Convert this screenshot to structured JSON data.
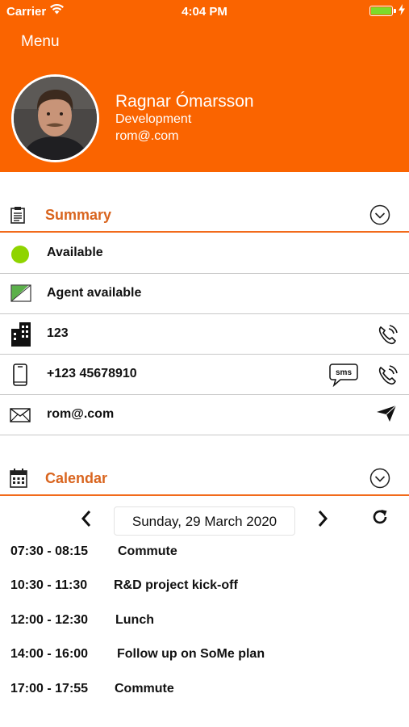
{
  "status_bar": {
    "carrier": "Carrier",
    "time": "4:04 PM",
    "battery_color": "#7ddb2a"
  },
  "header": {
    "menu_label": "Menu",
    "background_color": "#fa6400",
    "profile": {
      "name": "Ragnar Ómarsson",
      "department": "Development",
      "email": "rom@.com"
    }
  },
  "summary": {
    "title": "Summary",
    "icon": "clipboard-icon",
    "rows": [
      {
        "icon": "green-dot-icon",
        "text": "Available"
      },
      {
        "icon": "agent-status-icon",
        "text": "Agent available"
      },
      {
        "icon": "building-icon",
        "text": "123",
        "actions": [
          "phone-call-icon"
        ]
      },
      {
        "icon": "mobile-phone-icon",
        "text": "+123 45678910",
        "actions": [
          "sms-icon",
          "phone-call-icon"
        ]
      },
      {
        "icon": "envelope-icon",
        "text": "rom@.com",
        "actions": [
          "send-icon"
        ]
      }
    ]
  },
  "calendar": {
    "title": "Calendar",
    "icon": "calendar-icon",
    "date": "Sunday, 29 March 2020",
    "events": [
      {
        "time": "07:30 - 08:15",
        "title": "Commute"
      },
      {
        "time": "10:30 - 11:30",
        "title": "R&D project kick-off"
      },
      {
        "time": "12:00 - 12:30",
        "title": "Lunch"
      },
      {
        "time": "14:00 - 16:00",
        "title": "Follow up on SoMe plan"
      },
      {
        "time": "17:00 - 17:55",
        "title": "Commute"
      }
    ]
  },
  "colors": {
    "accent": "#fa6400",
    "section_title": "#d9651f",
    "available": "#8fd400"
  }
}
